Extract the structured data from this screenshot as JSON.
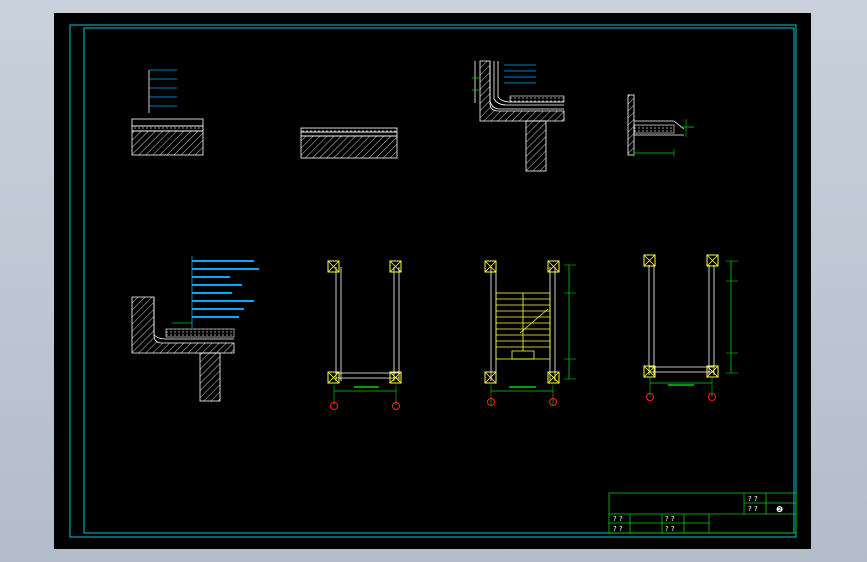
{
  "title_block": {
    "cell_a": "? ?",
    "cell_b": "? ?",
    "cell_c": "? ?",
    "cell_d": "? ?",
    "cell_e": "? ?",
    "cell_f": "? ?",
    "mark": "❷"
  },
  "colors": {
    "frame": "#00c8c8",
    "line": "#ffffff",
    "dim": "#00d000",
    "column": "#ffff40",
    "axis_bubble": "#ff2020",
    "note": "#00a8ff",
    "background": "#000000"
  },
  "icons": {
    "axis-bubble": "circle",
    "column-marker": "square-with-x"
  }
}
